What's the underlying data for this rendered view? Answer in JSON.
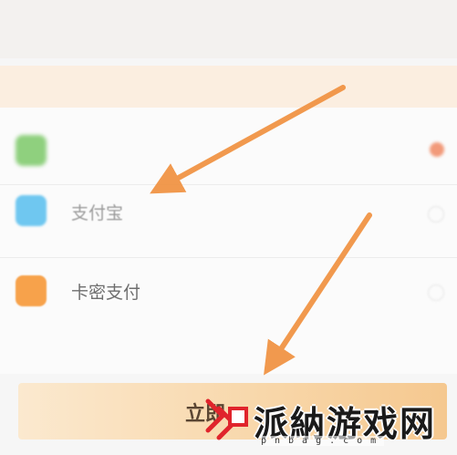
{
  "header": {
    "title": ""
  },
  "notice": {
    "text": ""
  },
  "payment_methods": [
    {
      "label": "",
      "icon": "wechat-pay-icon",
      "color": "#8fd07e",
      "selected": true
    },
    {
      "label": "支付宝",
      "icon": "alipay-icon",
      "color": "#6fc7f0",
      "selected": false
    },
    {
      "label": "卡密支付",
      "icon": "card-code-icon",
      "color": "#f7a24b",
      "selected": false
    }
  ],
  "submit_button": {
    "label": "立即"
  },
  "watermark": {
    "text": "派納游戏网",
    "sub": "pnbag.com"
  },
  "colors": {
    "accent_orange": "#f08f3c",
    "button": "#f8d6a8",
    "notice_bg": "#fbeee0"
  }
}
